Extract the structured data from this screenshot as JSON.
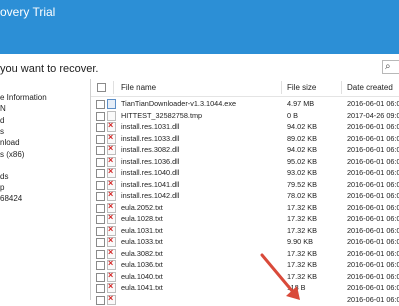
{
  "window": {
    "title": "overy Trial"
  },
  "subtitle": "you want to recover.",
  "search_icon": "search-icon",
  "tree": {
    "items": [
      "e Information",
      "N",
      "d",
      "s",
      "nload",
      "s (x86)",
      "",
      "ds",
      "p",
      "68424"
    ]
  },
  "columns": {
    "name": "File name",
    "size": "File size",
    "date": "Date created"
  },
  "files": [
    {
      "name": "TianTianDownloader-v1.3.1044.exe",
      "size": "4.97 MB",
      "date": "2016-06-01 06:0",
      "type": "exe"
    },
    {
      "name": "HITTEST_32582758.tmp",
      "size": "0 B",
      "date": "2017-04-26 09:0",
      "type": "blank"
    },
    {
      "name": "install.res.1031.dll",
      "size": "94.02 KB",
      "date": "2016-06-01 06:0",
      "type": "deleted"
    },
    {
      "name": "install.res.1033.dll",
      "size": "89.02 KB",
      "date": "2016-06-01 06:0",
      "type": "deleted"
    },
    {
      "name": "install.res.3082.dll",
      "size": "94.02 KB",
      "date": "2016-06-01 06:0",
      "type": "deleted"
    },
    {
      "name": "install.res.1036.dll",
      "size": "95.02 KB",
      "date": "2016-06-01 06:0",
      "type": "deleted"
    },
    {
      "name": "install.res.1040.dll",
      "size": "93.02 KB",
      "date": "2016-06-01 06:0",
      "type": "deleted"
    },
    {
      "name": "install.res.1041.dll",
      "size": "79.52 KB",
      "date": "2016-06-01 06:0",
      "type": "deleted"
    },
    {
      "name": "install.res.1042.dll",
      "size": "78.02 KB",
      "date": "2016-06-01 06:0",
      "type": "deleted"
    },
    {
      "name": "eula.2052.txt",
      "size": "17.32 KB",
      "date": "2016-06-01 06:0",
      "type": "deleted"
    },
    {
      "name": "eula.1028.txt",
      "size": "17.32 KB",
      "date": "2016-06-01 06:0",
      "type": "deleted"
    },
    {
      "name": "eula.1031.txt",
      "size": "17.32 KB",
      "date": "2016-06-01 06:0",
      "type": "deleted"
    },
    {
      "name": "eula.1033.txt",
      "size": "9.90 KB",
      "date": "2016-06-01 06:0",
      "type": "deleted"
    },
    {
      "name": "eula.3082.txt",
      "size": "17.32 KB",
      "date": "2016-06-01 06:0",
      "type": "deleted"
    },
    {
      "name": "eula.1036.txt",
      "size": "17.32 KB",
      "date": "2016-06-01 06:0",
      "type": "deleted"
    },
    {
      "name": "eula.1040.txt",
      "size": "17.32 KB",
      "date": "2016-06-01 06:0",
      "type": "deleted"
    },
    {
      "name": "eula.1041.txt",
      "size": "118 B",
      "date": "2016-06-01 06:0",
      "type": "deleted"
    },
    {
      "name": "",
      "size": "",
      "date": "2016-06-01 06:0",
      "type": "deleted"
    }
  ],
  "colors": {
    "titlebar": "#2c8fd6",
    "arrow": "#d94a3a",
    "deleted_mark": "#d32424"
  }
}
